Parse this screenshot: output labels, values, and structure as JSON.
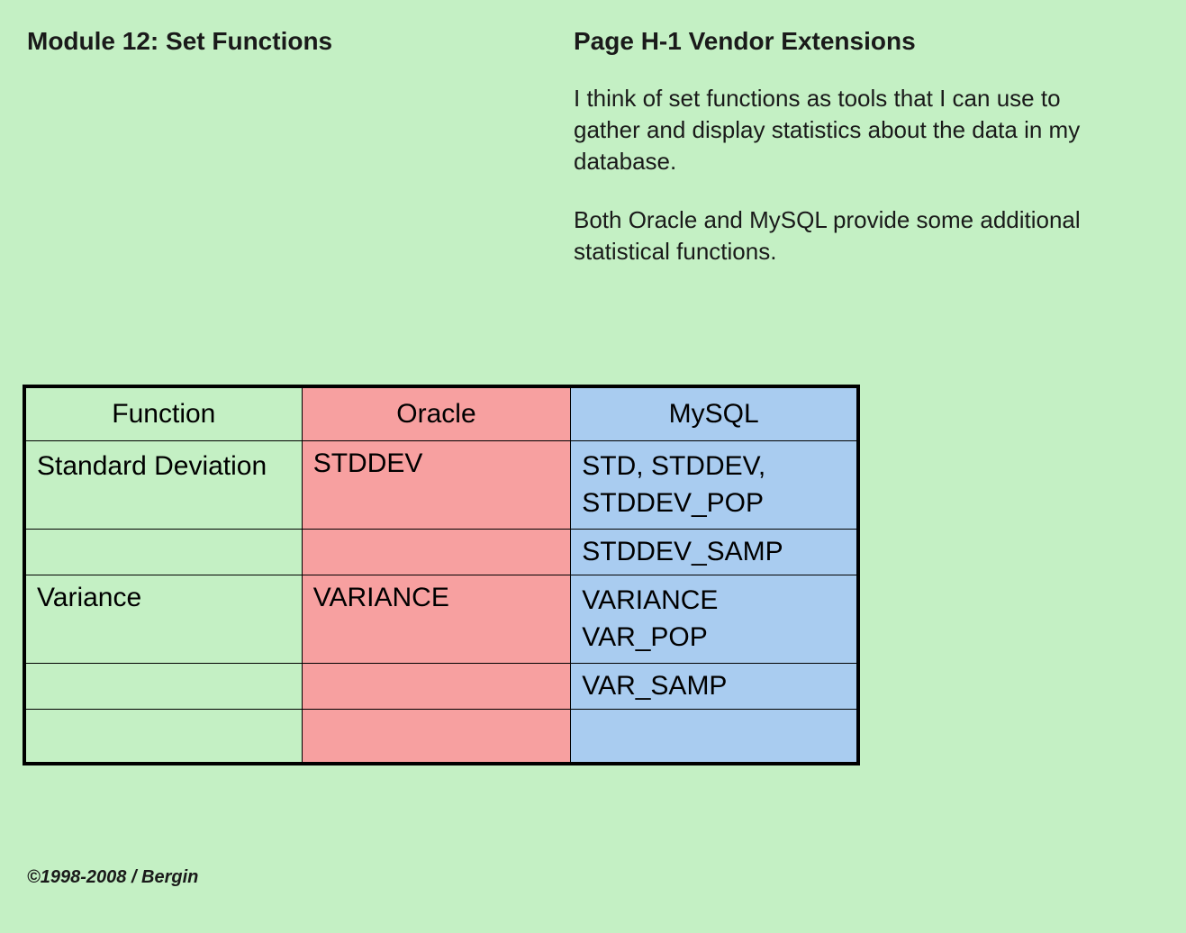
{
  "header": {
    "module_title": "Module 12: Set Functions",
    "page_title": "Page H-1 Vendor Extensions"
  },
  "body": {
    "paragraph1": "I think of set functions as tools that I can use to gather and display statistics about the data in my database.",
    "paragraph2": "Both Oracle and MySQL provide some additional statistical functions."
  },
  "table": {
    "headers": {
      "function": "Function",
      "oracle": "Oracle",
      "mysql": "MySQL"
    },
    "rows": [
      {
        "function": "Standard Deviation",
        "oracle": "STDDEV",
        "mysql": "STD, STDDEV, STDDEV_POP"
      },
      {
        "function": "",
        "oracle": "",
        "mysql": "STDDEV_SAMP"
      },
      {
        "function": "Variance",
        "oracle": "VARIANCE",
        "mysql": "VARIANCE\nVAR_POP"
      },
      {
        "function": "",
        "oracle": "",
        "mysql": "VAR_SAMP"
      },
      {
        "function": "",
        "oracle": "",
        "mysql": ""
      }
    ]
  },
  "footer": {
    "copyright": "©1998-2008 / Bergin"
  }
}
